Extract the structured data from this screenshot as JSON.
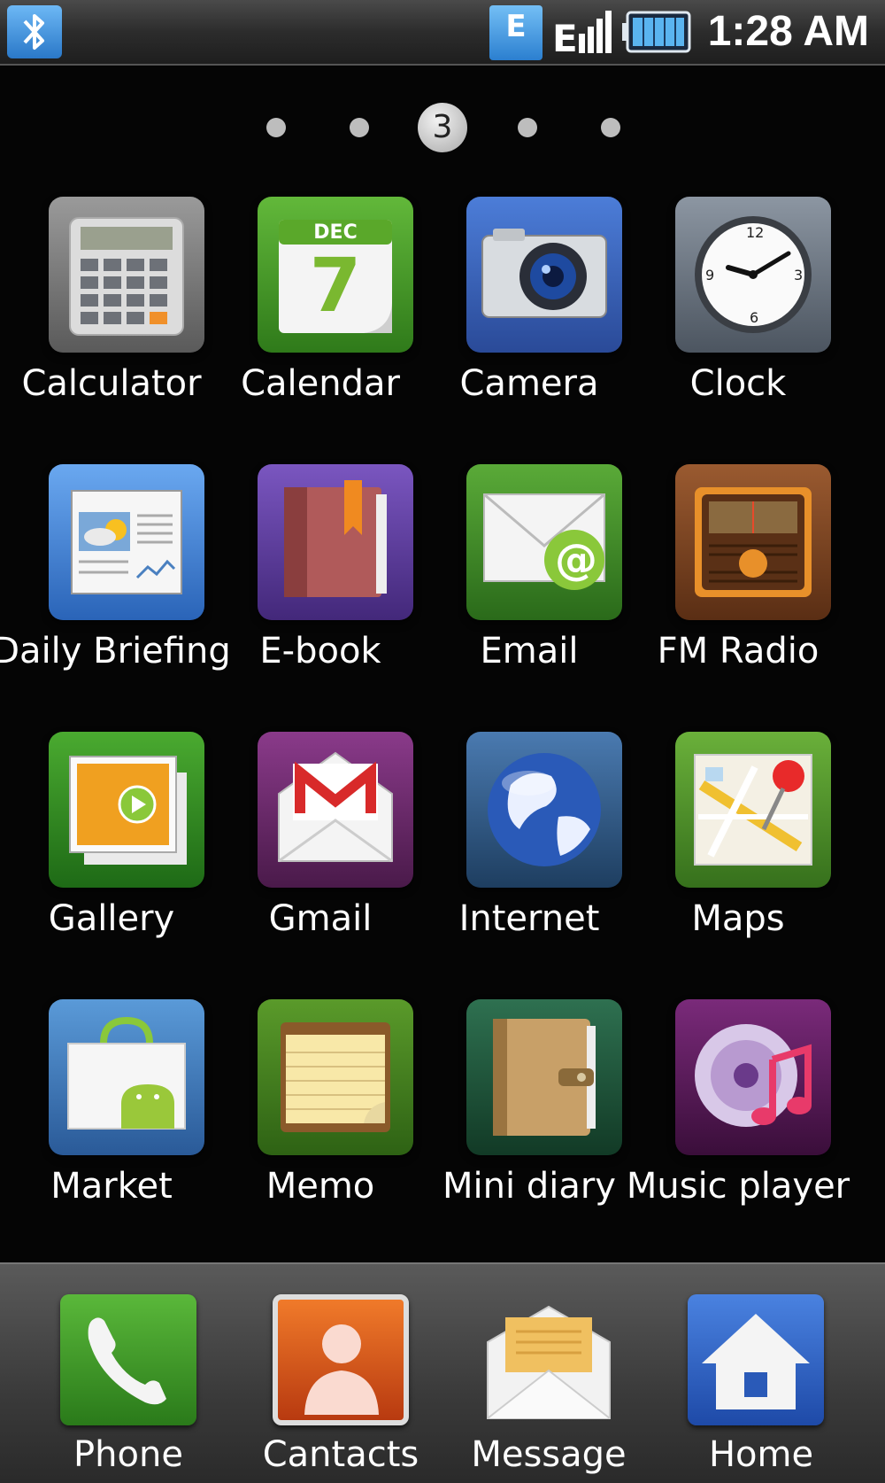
{
  "status_bar": {
    "network_type": "E",
    "time": "1:28 AM",
    "icons": [
      "bluetooth-icon",
      "edge-data-icon",
      "signal-icon",
      "battery-icon"
    ]
  },
  "page_indicator": {
    "current_page": "3",
    "total_pages": 5
  },
  "apps": [
    {
      "label": "Calculator",
      "icon": "calculator-icon",
      "color": "#7a7a7a"
    },
    {
      "label": "Calendar",
      "icon": "calendar-icon",
      "color": "#4a9a2a",
      "month": "DEC",
      "day": "7"
    },
    {
      "label": "Camera",
      "icon": "camera-icon",
      "color": "#3a64b8"
    },
    {
      "label": "Clock",
      "icon": "clock-icon",
      "color": "#66707c"
    },
    {
      "label": "Daily Briefing",
      "icon": "daily-briefing-icon",
      "color": "#3f7fd0"
    },
    {
      "label": "E-book",
      "icon": "ebook-icon",
      "color": "#5c3e9a"
    },
    {
      "label": "Email",
      "icon": "email-icon",
      "color": "#3e8a28"
    },
    {
      "label": "FM Radio",
      "icon": "radio-icon",
      "color": "#7a4422"
    },
    {
      "label": "Gallery",
      "icon": "gallery-icon",
      "color": "#3a8a22"
    },
    {
      "label": "Gmail",
      "icon": "gmail-icon",
      "color": "#6a2a6a"
    },
    {
      "label": "Internet",
      "icon": "globe-icon",
      "color": "#2f5a8a"
    },
    {
      "label": "Maps",
      "icon": "maps-icon",
      "color": "#4f8a28"
    },
    {
      "label": "Market",
      "icon": "market-icon",
      "color": "#3a74b0"
    },
    {
      "label": "Memo",
      "icon": "memo-icon",
      "color": "#3f7a22"
    },
    {
      "label": "Mini diary",
      "icon": "diary-icon",
      "color": "#1f5a3a"
    },
    {
      "label": "Music player",
      "icon": "music-icon",
      "color": "#5a1f5a"
    }
  ],
  "dock": [
    {
      "label": "Phone",
      "icon": "phone-icon",
      "color": "#3a9a2a"
    },
    {
      "label": "Cantacts",
      "icon": "contacts-icon",
      "color": "#d85a1a"
    },
    {
      "label": "Message",
      "icon": "message-icon",
      "color": "#e8c070"
    },
    {
      "label": "Home",
      "icon": "home-icon",
      "color": "#2a5ab8"
    }
  ]
}
